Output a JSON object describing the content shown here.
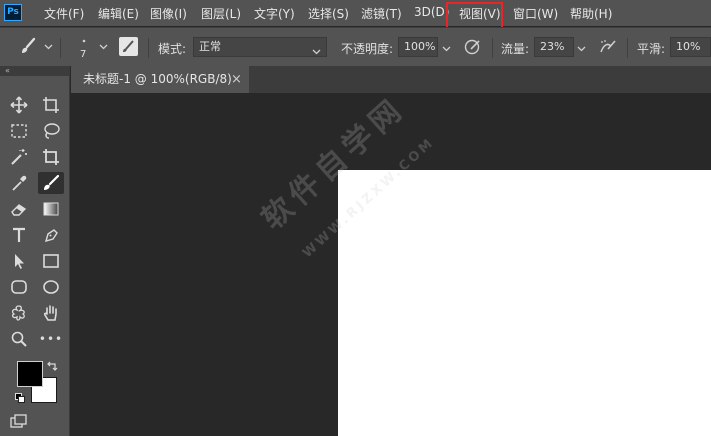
{
  "app": {
    "logo_text": "Ps"
  },
  "menu": [
    {
      "label": "文件(F)"
    },
    {
      "label": "编辑(E)"
    },
    {
      "label": "图像(I)"
    },
    {
      "label": "图层(L)"
    },
    {
      "label": "文字(Y)"
    },
    {
      "label": "选择(S)"
    },
    {
      "label": "滤镜(T)"
    },
    {
      "label": "3D(D)"
    },
    {
      "label": "视图(V)"
    },
    {
      "label": "窗口(W)"
    },
    {
      "label": "帮助(H)"
    }
  ],
  "highlight": {
    "color": "#e8262a",
    "target": "视图(V)"
  },
  "options": {
    "brush_size": "7",
    "mode_label": "模式:",
    "mode_value": "正常",
    "opacity_label": "不透明度:",
    "opacity_value": "100%",
    "flow_label": "流量:",
    "flow_value": "23%",
    "smoothing_label": "平滑:",
    "smoothing_value": "10%"
  },
  "panel": {
    "collapse_glyph": "«"
  },
  "document": {
    "tab_title": "未标题-1 @ 100%(RGB/8)",
    "tab_close": "×"
  },
  "watermark": {
    "main": "软件自学网",
    "sub": "WWW.RJZXW.COM"
  },
  "toolbar": {
    "tools": [
      "move-tool",
      "artboard-tool",
      "marquee-tool",
      "lasso-tool",
      "magic-wand-tool",
      "crop-tool",
      "eyedropper-tool",
      "brush-tool",
      "eraser-tool",
      "gradient-tool",
      "type-tool",
      "pen-tool",
      "path-selection-tool",
      "rectangle-tool",
      "rounded-rectangle-tool",
      "ellipse-tool",
      "custom-shape-tool",
      "hand-tool",
      "zoom-tool",
      "more-tools"
    ],
    "active_tool": "brush-tool",
    "more_glyph": "•••"
  },
  "colors": {
    "foreground": "#000000",
    "background": "#ffffff",
    "accent": "#31a8ff"
  }
}
